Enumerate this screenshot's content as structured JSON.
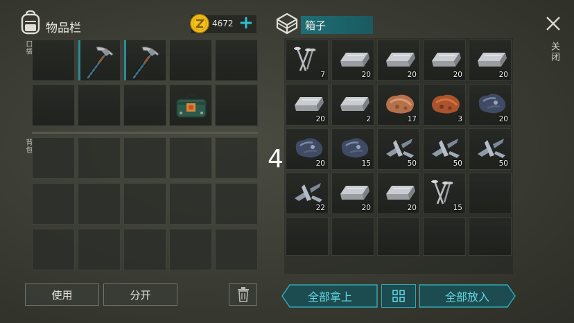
{
  "inventory": {
    "title": "物品栏",
    "icon": "backpack-icon",
    "coin_icon": "z-coin-icon",
    "coins": "4672",
    "add_label": "+",
    "pocket_label": "口袋",
    "backpack_label": "背包",
    "pocket_slots": [
      {
        "item": "",
        "qty": ""
      },
      {
        "item": "pickaxe",
        "qty": "",
        "selected": true
      },
      {
        "item": "pickaxe",
        "qty": "",
        "selected": true
      },
      {
        "item": "",
        "qty": ""
      },
      {
        "item": "",
        "qty": ""
      },
      {
        "item": "",
        "qty": ""
      },
      {
        "item": "",
        "qty": ""
      },
      {
        "item": "",
        "qty": ""
      },
      {
        "item": "dynamite-bundle",
        "qty": ""
      },
      {
        "item": "",
        "qty": ""
      }
    ]
  },
  "chest": {
    "icon": "chest-icon",
    "name": "箱子",
    "slots": [
      {
        "item": "nails",
        "qty": "7"
      },
      {
        "item": "iron-ingot",
        "qty": "20"
      },
      {
        "item": "iron-ingot",
        "qty": "20"
      },
      {
        "item": "iron-ingot",
        "qty": "20"
      },
      {
        "item": "iron-ingot",
        "qty": "20"
      },
      {
        "item": "iron-ingot",
        "qty": "20"
      },
      {
        "item": "iron-ingot",
        "qty": "2"
      },
      {
        "item": "copper-ore",
        "qty": "17"
      },
      {
        "item": "copper-ore-dark",
        "qty": "3"
      },
      {
        "item": "iron-ore",
        "qty": "20"
      },
      {
        "item": "iron-ore",
        "qty": "20"
      },
      {
        "item": "iron-ore",
        "qty": "15"
      },
      {
        "item": "metal-scrap",
        "qty": "50"
      },
      {
        "item": "metal-scrap",
        "qty": "50"
      },
      {
        "item": "metal-scrap",
        "qty": "50"
      },
      {
        "item": "metal-scrap",
        "qty": "22"
      },
      {
        "item": "iron-ingot",
        "qty": "20"
      },
      {
        "item": "iron-ingot",
        "qty": "20"
      },
      {
        "item": "nails",
        "qty": "15"
      },
      {
        "item": "",
        "qty": ""
      }
    ]
  },
  "overlay_number": "4",
  "close": {
    "icon": "close-icon",
    "label": "关闭"
  },
  "buttons": {
    "use": "使用",
    "split": "分开",
    "trash_icon": "trash-icon",
    "take_all": "全部拿上",
    "sort_icon": "sort-grid-icon",
    "put_all": "全部放入"
  },
  "colors": {
    "accent": "#62d6e2",
    "accent_dark": "#1f5a60",
    "coin": "#f3c21b"
  }
}
